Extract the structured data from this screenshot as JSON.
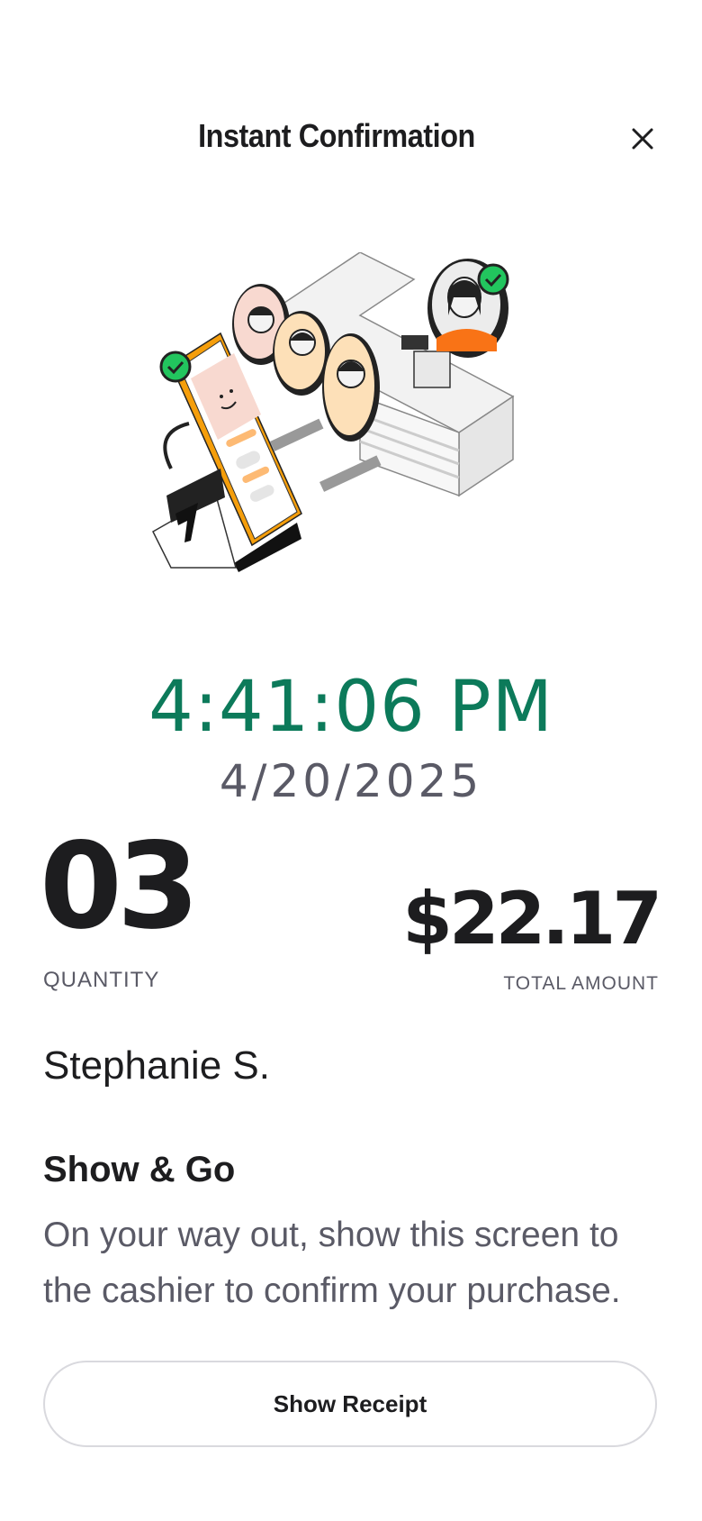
{
  "header": {
    "title": "Instant Confirmation",
    "close_icon": "close-icon"
  },
  "illustration": {
    "icon": "checkout-illustration",
    "colors": {
      "accent_green": "#22c55e",
      "accent_orange": "#f59e0b",
      "skin": "#fde0b8",
      "pink": "#f8d9d0"
    }
  },
  "confirmation": {
    "time": "4:41:06 PM",
    "date": "4/20/2025",
    "time_color": "#0c7a5a"
  },
  "summary": {
    "quantity_value": "03",
    "quantity_label": "QUANTITY",
    "amount_value": "$22.17",
    "amount_label": "TOTAL AMOUNT"
  },
  "customer": {
    "name": "Stephanie S."
  },
  "instructions": {
    "title": "Show & Go",
    "body": "On your way out, show this screen to the cashier to confirm your purchase."
  },
  "actions": {
    "show_receipt_label": "Show Receipt"
  }
}
